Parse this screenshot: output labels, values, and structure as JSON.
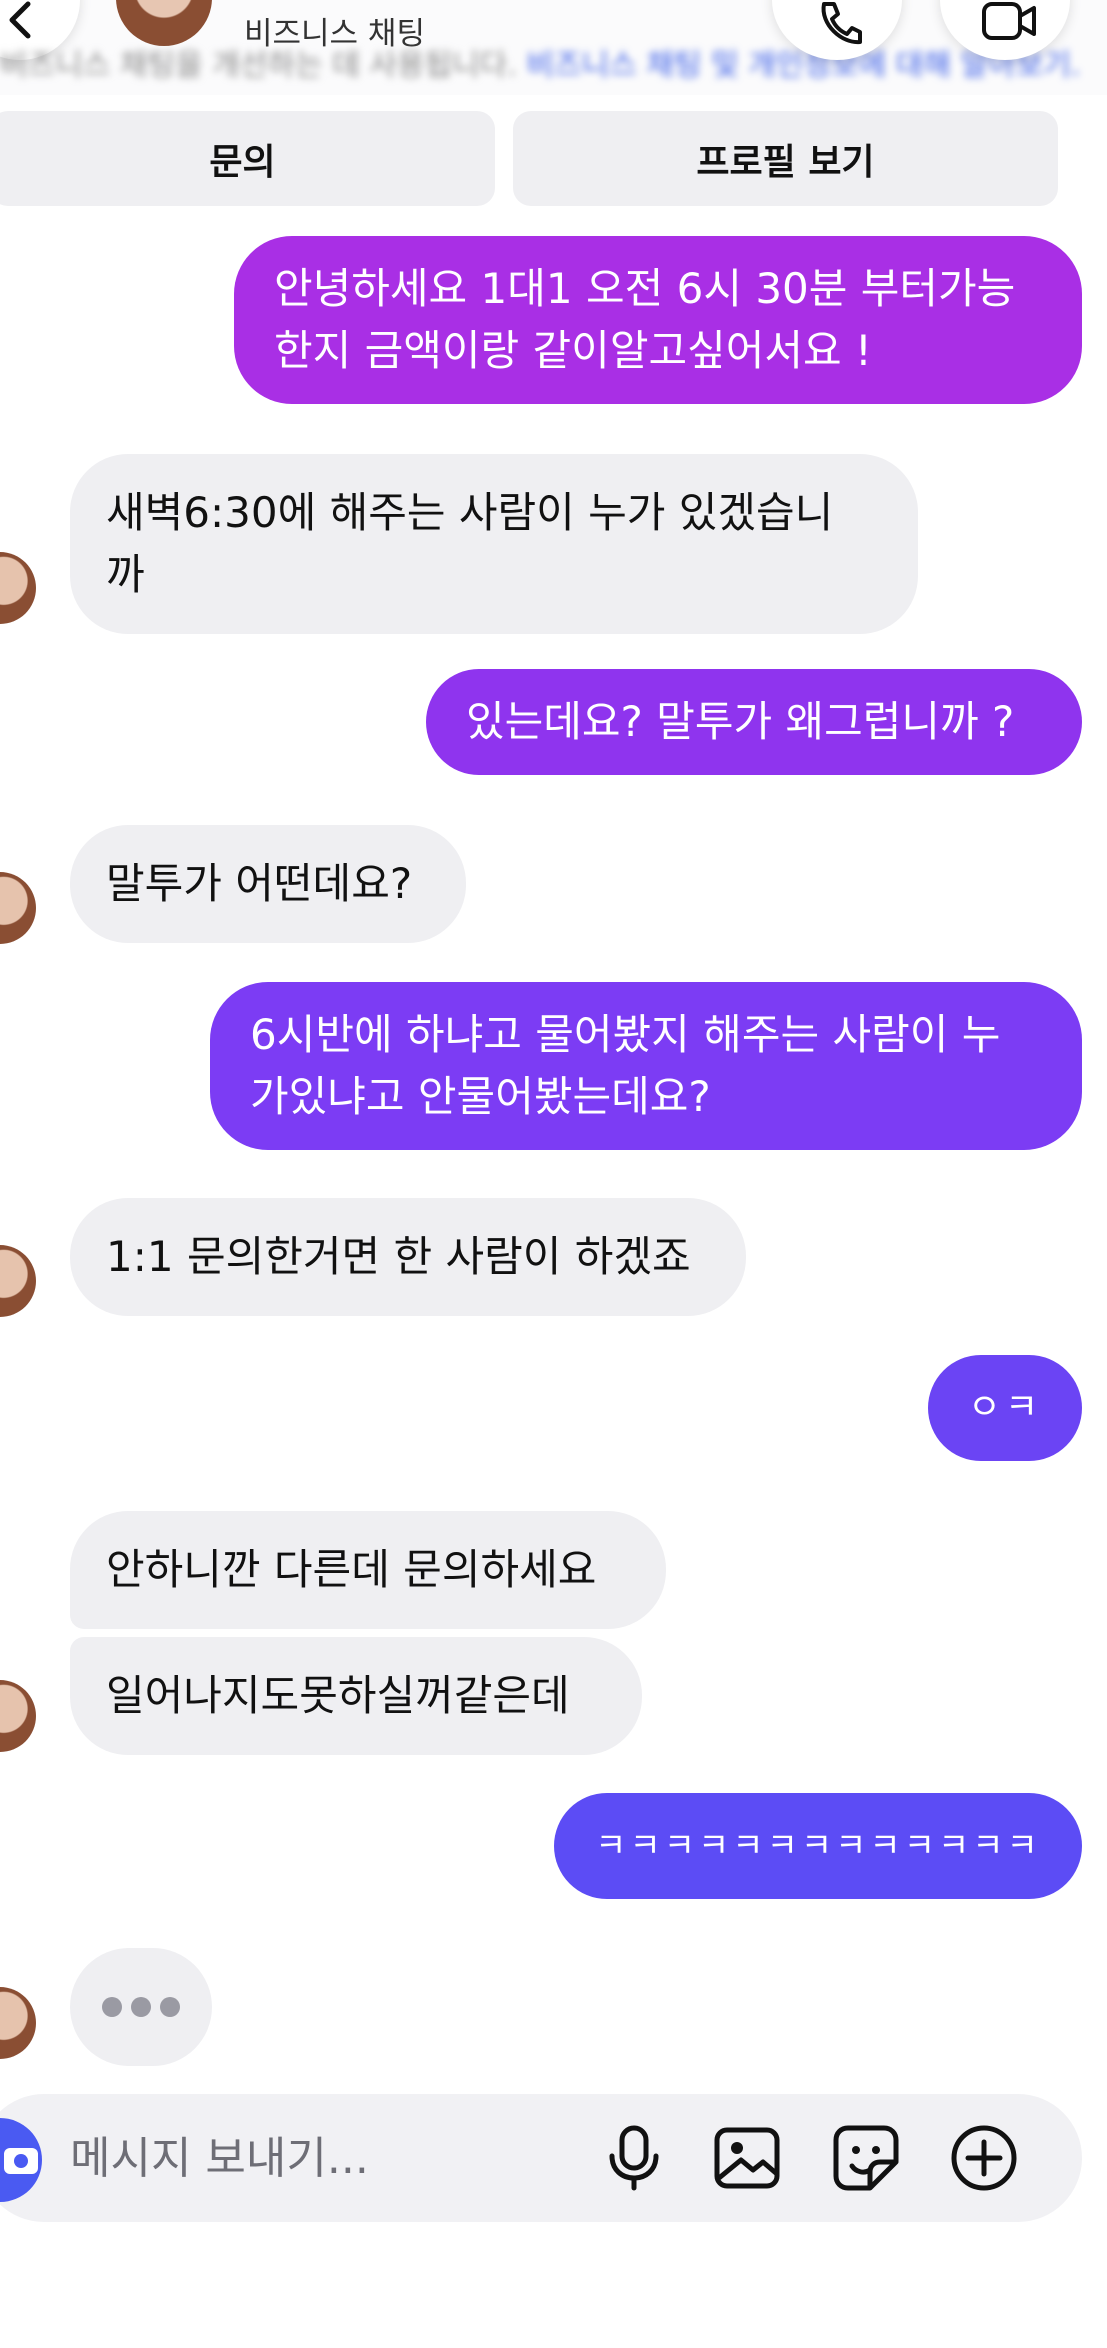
{
  "header": {
    "subtitle": "비즈니스 채팅",
    "notice_text": "비즈니스 채팅을 개선하는 데 사용됩니다.",
    "notice_link": "비즈니스 채팅 및 개인정보에 대해 알아보기."
  },
  "actions": {
    "inquiry_label": "문의",
    "profile_label": "프로필 보기"
  },
  "messages": [
    {
      "from": "me",
      "lines": [
        "안녕하세요 1대1 오전 6시 30분 부터가능",
        "한지 금액이랑 같이알고싶어서요 !"
      ]
    },
    {
      "from": "them",
      "lines": [
        "새벽6:30에 해주는 사람이 누가 있겠습니",
        "까"
      ]
    },
    {
      "from": "me",
      "lines": [
        "있는데요? 말투가 왜그럽니까 ?"
      ]
    },
    {
      "from": "them",
      "lines": [
        "말투가 어떤데요?"
      ]
    },
    {
      "from": "me",
      "lines": [
        "6시반에 하냐고 물어봤지 해주는 사람이 누",
        "가있냐고 안물어봤는데요?"
      ]
    },
    {
      "from": "them",
      "lines": [
        "1:1 문의한거면 한 사람이 하겠죠"
      ]
    },
    {
      "from": "me",
      "lines": [
        "ㅇㅋ"
      ]
    },
    {
      "from": "them",
      "lines": [
        "안하니깐 다른데 문의하세요"
      ]
    },
    {
      "from": "them",
      "lines": [
        "일어나지도못하실꺼같은데"
      ]
    },
    {
      "from": "me",
      "lines": [
        "ㅋㅋㅋㅋㅋㅋㅋㅋㅋㅋㅋㅋㅋ"
      ]
    }
  ],
  "composer": {
    "placeholder": "메시지 보내기..."
  },
  "icons": {
    "back": "chevron-left-icon",
    "call": "phone-icon",
    "video": "video-camera-icon",
    "camera": "camera-icon",
    "mic": "microphone-icon",
    "gallery": "image-icon",
    "sticker": "sticker-icon",
    "add": "plus-circle-icon"
  },
  "colors": {
    "gradient_top": "#a630e6",
    "gradient_mid": "#7a3cf5",
    "gradient_bottom": "#5a4df5",
    "incoming_bubble": "#efeff2",
    "accent": "#4a5af2"
  }
}
